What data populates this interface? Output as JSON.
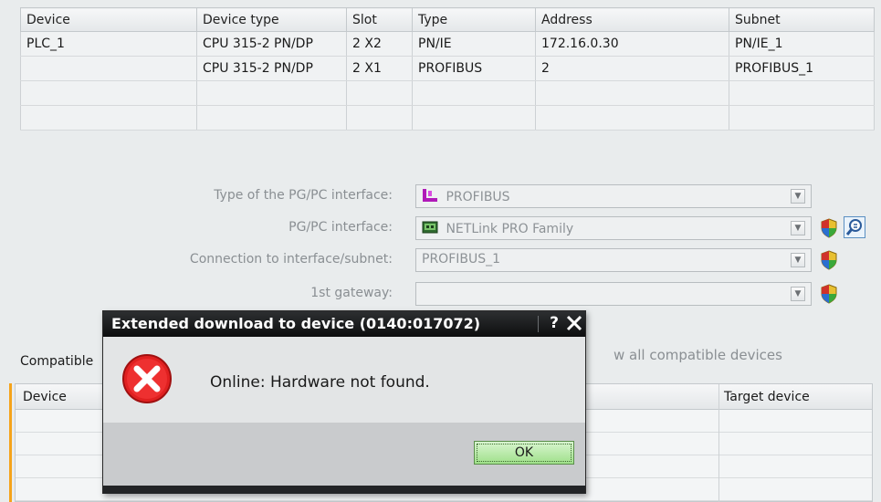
{
  "top_table": {
    "headers": [
      "Device",
      "Device type",
      "Slot",
      "Type",
      "Address",
      "Subnet"
    ],
    "rows": [
      [
        "PLC_1",
        "CPU 315-2 PN/DP",
        "2 X2",
        "PN/IE",
        "172.16.0.30",
        "PN/IE_1"
      ],
      [
        "",
        "CPU 315-2 PN/DP",
        "2 X1",
        "PROFIBUS",
        "2",
        "PROFIBUS_1"
      ],
      [
        "",
        "",
        "",
        "",
        "",
        ""
      ],
      [
        "",
        "",
        "",
        "",
        "",
        ""
      ]
    ]
  },
  "interface_form": {
    "pgpc_type_label": "Type of the PG/PC interface:",
    "pgpc_type_value": "PROFIBUS",
    "pgpc_interface_label": "PG/PC interface:",
    "pgpc_interface_value": "NETLink PRO Family",
    "connection_label": "Connection to interface/subnet:",
    "connection_value": "PROFIBUS_1",
    "gateway_label": "1st gateway:",
    "gateway_value": ""
  },
  "compatible": {
    "title": "Compatible",
    "show_all_label": "w all compatible devices",
    "headers": {
      "device": "Device",
      "target": "Target device"
    }
  },
  "dialog": {
    "title": "Extended download to device (0140:017072)",
    "help_label": "?",
    "message": "Online: Hardware not found.",
    "ok_label": "OK"
  },
  "colors": {
    "accent_orange": "#f5a31a",
    "error_red": "#e02020",
    "ok_green": "#9fe08a",
    "title_bar": "#1a1b1c"
  },
  "icons": [
    "profibus-icon",
    "netlink-icon",
    "shield-icon",
    "diagnostics-icon",
    "error-icon",
    "close-icon"
  ]
}
